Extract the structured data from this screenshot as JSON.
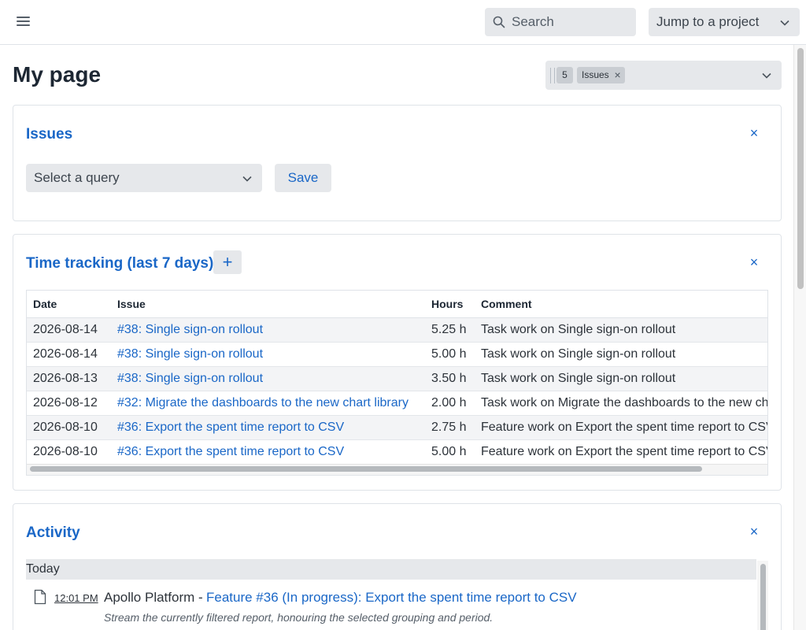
{
  "header": {
    "search_placeholder": "Search",
    "jump_label": "Jump to a project"
  },
  "page": {
    "title": "My page",
    "block_selector": {
      "count": "5",
      "tag": "Issues"
    }
  },
  "issues_block": {
    "title": "Issues",
    "query_placeholder": "Select a query",
    "save_label": "Save"
  },
  "time_block": {
    "title": "Time tracking (last 7 days)",
    "add_label": "+",
    "columns": [
      "Date",
      "Issue",
      "Hours",
      "Comment"
    ],
    "rows": [
      [
        "2026-08-14",
        "#38: Single sign-on rollout",
        "5.25 h",
        "Task work on Single sign-on rollout"
      ],
      [
        "2026-08-14",
        "#38: Single sign-on rollout",
        "5.00 h",
        "Task work on Single sign-on rollout"
      ],
      [
        "2026-08-13",
        "#38: Single sign-on rollout",
        "3.50 h",
        "Task work on Single sign-on rollout"
      ],
      [
        "2026-08-12",
        "#32: Migrate the dashboards to the new chart library",
        "2.00 h",
        "Task work on Migrate the dashboards to the new chart library"
      ],
      [
        "2026-08-10",
        "#36: Export the spent time report to CSV",
        "2.75 h",
        "Feature work on Export the spent time report to CSV"
      ],
      [
        "2026-08-10",
        "#36: Export the spent time report to CSV",
        "5.00 h",
        "Feature work on Export the spent time report to CSV"
      ]
    ]
  },
  "activity_block": {
    "title": "Activity",
    "day": "Today",
    "entries": [
      {
        "time": "12:01 PM",
        "project": "Apollo Platform -",
        "link": "Feature #36 (In progress): Export the spent time report to CSV",
        "description": "Stream the currently filtered report, honouring the selected grouping and period."
      }
    ]
  },
  "close_label": "×",
  "colors": {
    "accent": "#1a67c7",
    "chip_bg": "#e6e8eb",
    "text": "#1d2733"
  }
}
